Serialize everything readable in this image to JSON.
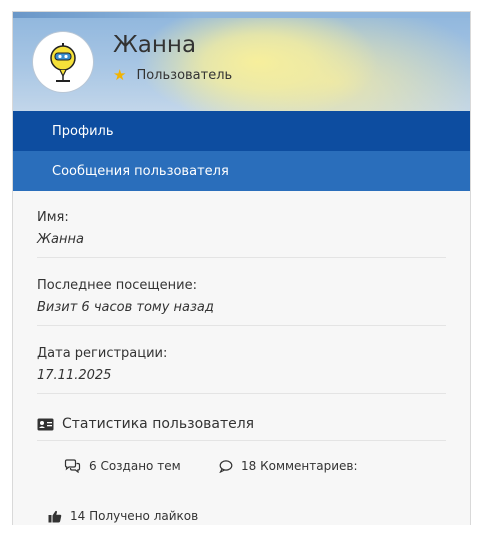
{
  "profile": {
    "name": "Жанна",
    "role": "Пользователь"
  },
  "nav": [
    {
      "label": "Профиль"
    },
    {
      "label": "Сообщения пользователя"
    }
  ],
  "fields": [
    {
      "label": "Имя:",
      "value": "Жанна"
    },
    {
      "label": "Последнее посещение:",
      "value": "Визит 6 часов тому назад"
    },
    {
      "label": "Дата регистрации:",
      "value": "17.11.2025"
    }
  ],
  "stats": {
    "title": "Статистика пользователя",
    "topics": "6 Создано тем",
    "comments": "18 Комментариев:",
    "likes": "14 Получено лайков"
  },
  "colors": {
    "nav_active": "#0d4da0",
    "nav_inactive": "#2a6ebb",
    "star": "#f2b300"
  }
}
